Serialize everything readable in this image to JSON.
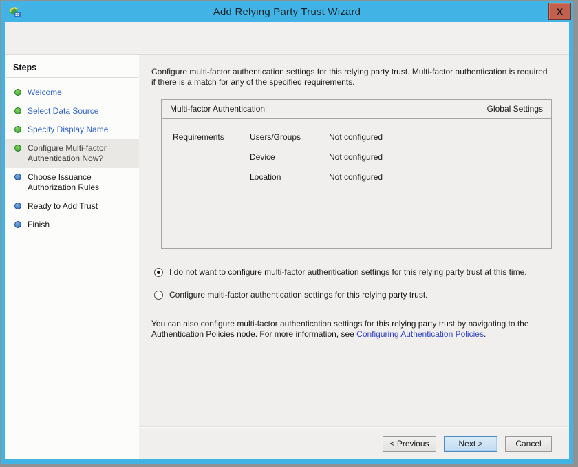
{
  "window": {
    "title": "Add Relying Party Trust Wizard",
    "close_label": "X"
  },
  "sidebar": {
    "title": "Steps",
    "items": [
      {
        "label": "Welcome",
        "state": "done"
      },
      {
        "label": "Select Data Source",
        "state": "done"
      },
      {
        "label": "Specify Display Name",
        "state": "done"
      },
      {
        "label": "Configure Multi-factor Authentication Now?",
        "state": "current"
      },
      {
        "label": "Choose Issuance Authorization Rules",
        "state": "upcoming"
      },
      {
        "label": "Ready to Add Trust",
        "state": "upcoming"
      },
      {
        "label": "Finish",
        "state": "upcoming"
      }
    ]
  },
  "main": {
    "intro": "Configure multi-factor authentication settings for this relying party trust. Multi-factor authentication is required if there is a match for any of the specified requirements.",
    "table": {
      "header_left": "Multi-factor Authentication",
      "header_right": "Global Settings",
      "rows": [
        {
          "group": "Requirements",
          "name": "Users/Groups",
          "value": "Not configured"
        },
        {
          "group": "",
          "name": "Device",
          "value": "Not configured"
        },
        {
          "group": "",
          "name": "Location",
          "value": "Not configured"
        }
      ]
    },
    "radios": [
      {
        "label": "I do not want to configure multi-factor authentication settings for this relying party trust at this time.",
        "selected": true
      },
      {
        "label": "Configure multi-factor authentication settings for this relying party trust.",
        "selected": false
      }
    ],
    "note_before_link": "You can also configure multi-factor authentication settings for this relying party trust by navigating to the Authentication Policies node. For more information, see ",
    "note_link": "Configuring Authentication Policies",
    "note_after_link": "."
  },
  "footer": {
    "previous_label": "< Previous",
    "next_label": "Next >",
    "cancel_label": "Cancel"
  },
  "colors": {
    "titlebar_blue": "#42B3E5",
    "close_button_red": "#C2604B",
    "done_bullet_green": "#2F9E31",
    "upcoming_bullet_blue": "#2663B5",
    "sidebar_link_blue": "#3465CC",
    "hyperlink_blue": "#3344C5",
    "default_button_fill": "#C3DDF3"
  }
}
